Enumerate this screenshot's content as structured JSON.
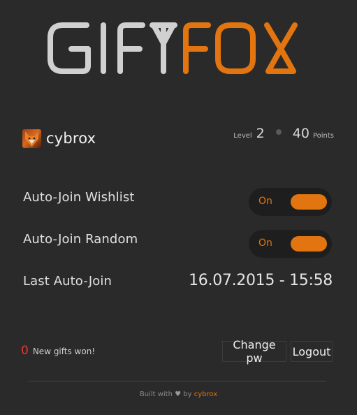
{
  "logo": {
    "part1": "GIFT",
    "part2": "FOX",
    "color1": "#d0d0d0",
    "color2": "#e2750f"
  },
  "user": {
    "name": "cybrox",
    "level_label": "Level",
    "level": "2",
    "points": "40",
    "points_label": "Points"
  },
  "settings": {
    "wishlist": {
      "label": "Auto-Join Wishlist",
      "state": "On"
    },
    "random": {
      "label": "Auto-Join Random",
      "state": "On"
    },
    "last": {
      "label": "Last Auto-Join",
      "value": "16.07.2015 - 15:58"
    }
  },
  "gifts": {
    "count": "0",
    "text": "New gifts won!"
  },
  "buttons": {
    "change_pw": "Change pw",
    "logout": "Logout"
  },
  "footer": {
    "prefix": "Built with",
    "heart": "♥",
    "by": "by",
    "author": "cybrox"
  },
  "colors": {
    "accent": "#e2750f",
    "background": "#2a2a2a",
    "toggle_bg": "#1e1e1e",
    "error": "#e53935"
  }
}
